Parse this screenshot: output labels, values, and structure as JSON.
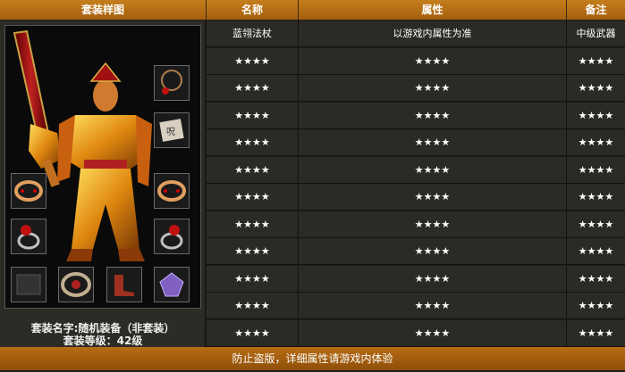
{
  "header": {
    "col_image": "套装样图",
    "col_name": "名称",
    "col_attr": "属性",
    "col_note": "备注"
  },
  "set_info": {
    "name_line": "套装名字:随机装备（非套装）",
    "level_line": "套装等级：42级"
  },
  "rows": [
    {
      "name": "蓝翎法杖",
      "attr": "以游戏内属性为准",
      "note": "中级武器"
    },
    {
      "name": "★★★★",
      "attr": "★★★★",
      "note": "★★★★"
    },
    {
      "name": "★★★★",
      "attr": "★★★★",
      "note": "★★★★"
    },
    {
      "name": "★★★★",
      "attr": "★★★★",
      "note": "★★★★"
    },
    {
      "name": "★★★★",
      "attr": "★★★★",
      "note": "★★★★"
    },
    {
      "name": "★★★★",
      "attr": "★★★★",
      "note": "★★★★"
    },
    {
      "name": "★★★★",
      "attr": "★★★★",
      "note": "★★★★"
    },
    {
      "name": "★★★★",
      "attr": "★★★★",
      "note": "★★★★"
    },
    {
      "name": "★★★★",
      "attr": "★★★★",
      "note": "★★★★"
    },
    {
      "name": "★★★★",
      "attr": "★★★★",
      "note": "★★★★"
    },
    {
      "name": "★★★★",
      "attr": "★★★★",
      "note": "★★★★"
    },
    {
      "name": "★★★★",
      "attr": "★★★★",
      "note": "★★★★"
    }
  ],
  "footer": {
    "notice": "防止盗版，详细属性请游戏内体验"
  },
  "colors": {
    "header": "#b46a14",
    "cell": "#2b2a26",
    "gold": "#f0a020"
  },
  "equipment_icons": [
    "necklace-icon",
    "tome-icon",
    "bracelet-left-icon",
    "bracelet-right-icon",
    "ring-left-icon",
    "ring-right-icon",
    "medal-icon",
    "belt-icon",
    "boots-icon",
    "gem-icon"
  ]
}
